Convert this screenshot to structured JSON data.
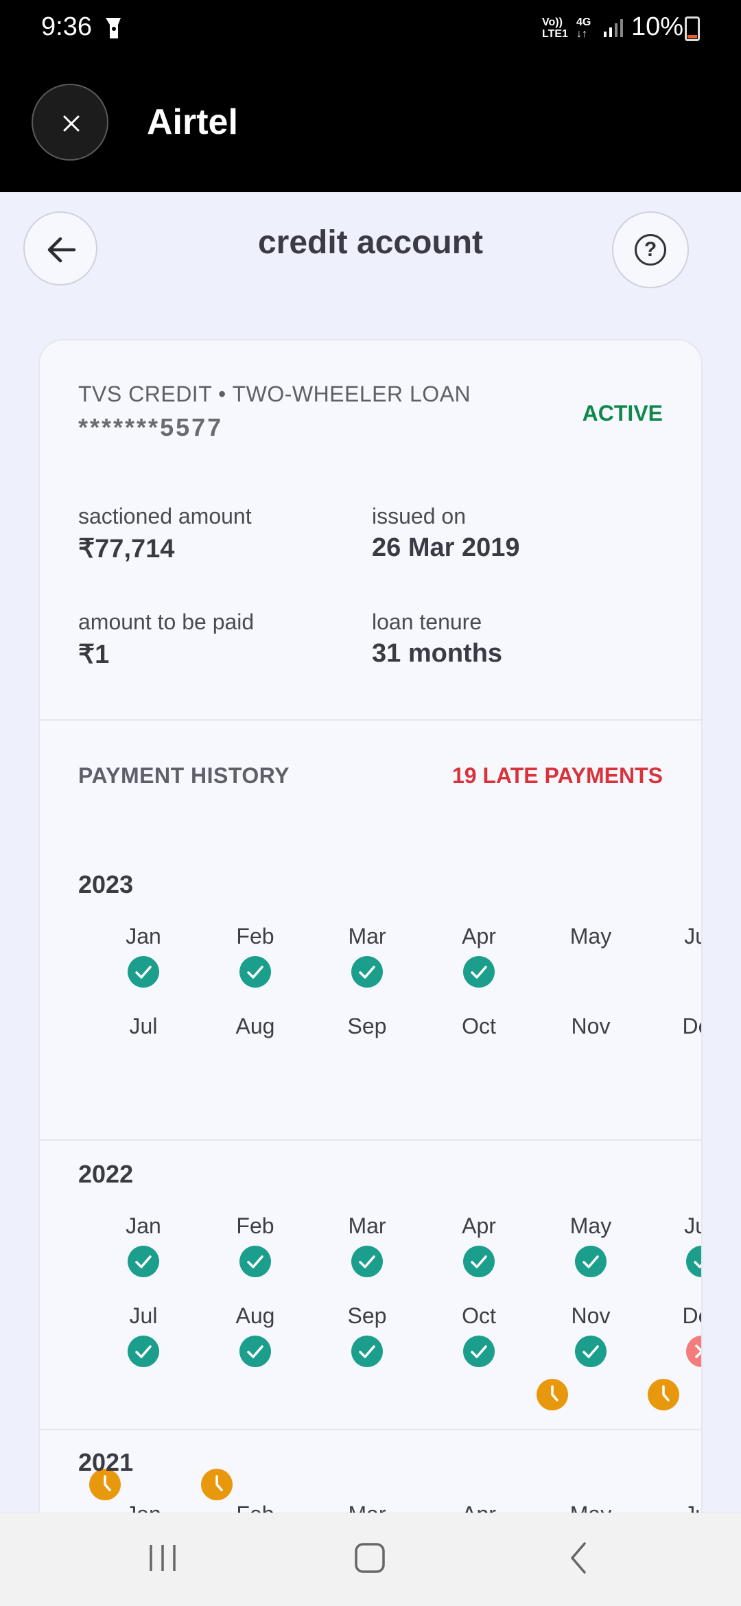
{
  "status_bar": {
    "time": "9:36",
    "network_volte": "Vo))",
    "network_lte": "LTE1",
    "network_4g": "4G",
    "network_arrows": "↓↑",
    "battery": "10%"
  },
  "app_bar": {
    "title": "Airtel"
  },
  "header": {
    "title": "credit account"
  },
  "account": {
    "lender": "TVS CREDIT • TWO-WHEELER LOAN",
    "number": "*******5577",
    "status": "ACTIVE",
    "status_color": "#11884b",
    "sanctioned_label": "sactioned amount",
    "sanctioned_value": "₹77,714",
    "issued_label": "issued on",
    "issued_value": "26 Mar 2019",
    "due_label": "amount to be paid",
    "due_value": "₹1",
    "tenure_label": "loan tenure",
    "tenure_value": "31 months"
  },
  "payment_history": {
    "title": "PAYMENT HISTORY",
    "late_summary": "19 LATE PAYMENTS",
    "late_color": "#d8333b",
    "years": [
      {
        "year": "2023",
        "months": [
          {
            "label": "Jan",
            "status": "ontime"
          },
          {
            "label": "Feb",
            "status": "ontime"
          },
          {
            "label": "Mar",
            "status": "ontime"
          },
          {
            "label": "Apr",
            "status": "ontime"
          },
          {
            "label": "May",
            "status": "late"
          },
          {
            "label": "Jun",
            "status": "late"
          },
          {
            "label": "Jul",
            "status": "late"
          },
          {
            "label": "Aug",
            "status": "late"
          },
          {
            "label": "Sep",
            "status": "none"
          },
          {
            "label": "Oct",
            "status": "none"
          },
          {
            "label": "Nov",
            "status": "none"
          },
          {
            "label": "Dec",
            "status": "none"
          }
        ]
      },
      {
        "year": "2022",
        "months": [
          {
            "label": "Jan",
            "status": "ontime"
          },
          {
            "label": "Feb",
            "status": "ontime"
          },
          {
            "label": "Mar",
            "status": "ontime"
          },
          {
            "label": "Apr",
            "status": "ontime"
          },
          {
            "label": "May",
            "status": "ontime"
          },
          {
            "label": "Jun",
            "status": "ontime"
          },
          {
            "label": "Jul",
            "status": "ontime"
          },
          {
            "label": "Aug",
            "status": "ontime"
          },
          {
            "label": "Sep",
            "status": "ontime"
          },
          {
            "label": "Oct",
            "status": "ontime"
          },
          {
            "label": "Nov",
            "status": "ontime"
          },
          {
            "label": "Dec",
            "status": "missed"
          }
        ]
      },
      {
        "year": "2021",
        "months": [
          {
            "label": "Jan",
            "status": "cut"
          },
          {
            "label": "Feb",
            "status": "cut"
          },
          {
            "label": "Mar",
            "status": "cut"
          },
          {
            "label": "Apr",
            "status": "cut"
          },
          {
            "label": "May",
            "status": "cut"
          },
          {
            "label": "Jun",
            "status": "cut"
          }
        ]
      }
    ]
  },
  "status_colors": {
    "ontime": "#1b9e8b",
    "late": "#e8980c",
    "missed": "#f47c7c"
  },
  "nav_icons": [
    "recent-apps-icon",
    "home-icon",
    "back-nav-icon"
  ]
}
